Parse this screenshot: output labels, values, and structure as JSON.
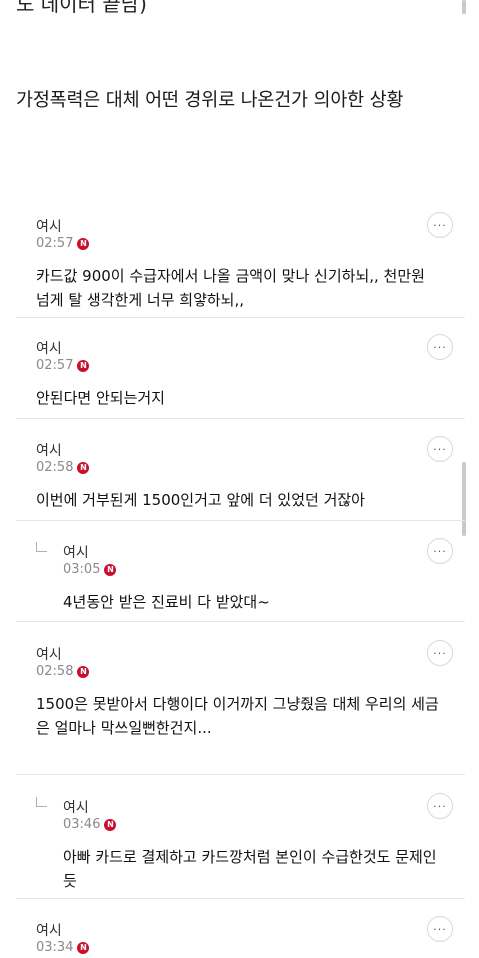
{
  "page": {
    "top_cut_text": "도 데이터 끝남)",
    "headline": "가정폭력은 대체 어떤 경위로 나온건가 의아한 상황"
  },
  "badge_letter": "N",
  "more_label": "···",
  "comments": [
    {
      "nick": "여시",
      "time": "02:57",
      "body": "카드값 900이 수급자에서 나올 금액이 맞나 신기하뇌,, 천만원\n넘게 탈 생각한게 너무 희얗하뇌,,",
      "reply": false
    },
    {
      "nick": "여시",
      "time": "02:57",
      "body": "안된다면 안되는거지",
      "reply": false
    },
    {
      "nick": "여시",
      "time": "02:58",
      "body": "이번에 거부된게 1500인거고 앞에 더 있었던 거잖아",
      "reply": false
    },
    {
      "nick": "여시",
      "time": "03:05",
      "body": "4년동안 받은 진료비 다 받았대~",
      "reply": true
    },
    {
      "nick": "여시",
      "time": "02:58",
      "body": "1500은 못받아서 다행이다 이거까지 그냥줬음 대체 우리의 세금\n은 얼마나 막쓰일뻔한건지...",
      "reply": false
    },
    {
      "nick": "여시",
      "time": "03:46",
      "body": "아빠 카드로 결제하고 카드깡처럼 본인이 수급한것도 문제인\n듯",
      "reply": true
    },
    {
      "nick": "여시",
      "time": "03:34",
      "body": "",
      "reply": false
    }
  ],
  "colors": {
    "badge": "#c8102e",
    "divider": "#e6e6e6",
    "time": "#8a8a8a"
  }
}
